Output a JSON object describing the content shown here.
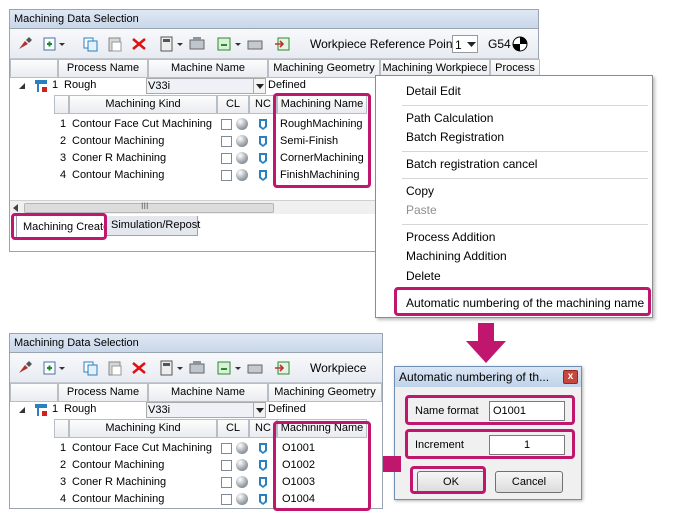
{
  "top": {
    "title": "Machining Data Selection",
    "toolbar": {
      "workpiece_label": "Workpiece Reference Point",
      "workpiece_value": "1",
      "coord_label": "G54"
    },
    "columns": [
      "Process Name",
      "Machine Name",
      "Machining Geometry",
      "Machining Workpiece",
      "Process"
    ],
    "process_row": {
      "num": "1",
      "name": "Rough",
      "machine": "V33i",
      "geometry": "Defined"
    },
    "sub_columns": [
      "Machining Kind",
      "CL",
      "NC",
      "Machining Name"
    ],
    "rows": [
      {
        "num": "1",
        "kind": "Contour Face Cut Machining",
        "name": "RoughMachining"
      },
      {
        "num": "2",
        "kind": "Contour Machining",
        "name": "Semi-Finish"
      },
      {
        "num": "3",
        "kind": "Coner R Machining",
        "name": "CornerMachining"
      },
      {
        "num": "4",
        "kind": "Contour Machining",
        "name": "FinishMachining"
      }
    ],
    "scroll_marker": "III",
    "tabs": [
      "Machining Create",
      "Simulation/Repost"
    ]
  },
  "menu": {
    "items": [
      "Detail Edit",
      "Path Calculation",
      "Batch Registration",
      "Batch registration cancel",
      "Copy",
      "Paste",
      "Process Addition",
      "Machining Addition",
      "Delete",
      "Automatic numbering of the machining name"
    ]
  },
  "bottom": {
    "title": "Machining Data Selection",
    "toolbar": {
      "workpiece_label": "Workpiece"
    },
    "columns": [
      "Process Name",
      "Machine Name",
      "Machining Geometry"
    ],
    "process_row": {
      "num": "1",
      "name": "Rough",
      "machine": "V33i",
      "geometry": "Defined"
    },
    "sub_columns": [
      "Machining Kind",
      "CL",
      "NC",
      "Machining Name"
    ],
    "rows": [
      {
        "num": "1",
        "kind": "Contour Face Cut Machining",
        "name": "O1001"
      },
      {
        "num": "2",
        "kind": "Contour Machining",
        "name": "O1002"
      },
      {
        "num": "3",
        "kind": "Coner R Machining",
        "name": "O1003"
      },
      {
        "num": "4",
        "kind": "Contour Machining",
        "name": "O1004"
      }
    ]
  },
  "dialog": {
    "title": "Automatic numbering of th...",
    "close": "x",
    "name_format_label": "Name format",
    "name_format_value": "O1001",
    "increment_label": "Increment",
    "increment_value": "1",
    "ok": "OK",
    "cancel": "Cancel"
  },
  "colors": {
    "highlight": "#c1166e"
  }
}
